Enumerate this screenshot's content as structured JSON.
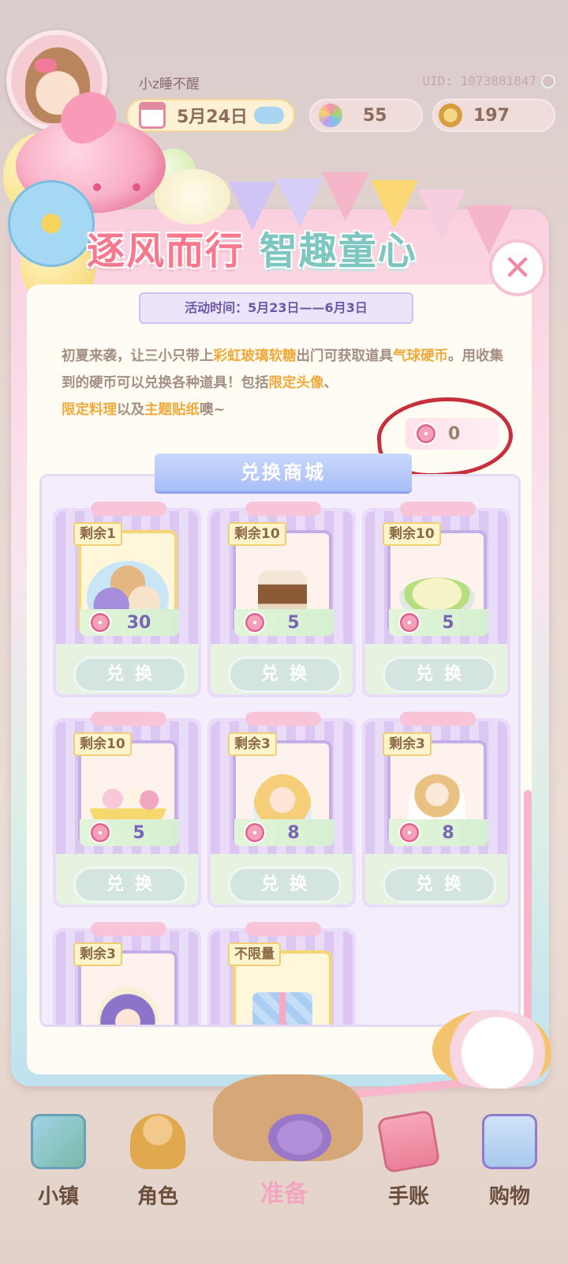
{
  "player": {
    "name": "小z睡不醒",
    "uid": "UID: 1073881847",
    "date": "5月24日",
    "gems": "55",
    "coins": "197"
  },
  "event": {
    "title_part1": "逐风而行",
    "title_part2": "智趣童心",
    "time": "活动时间：5月23日——6月3日",
    "desc": {
      "p1": "初夏来袭，让三小只带上",
      "h1": "彩虹玻璃软糖",
      "p2": "出门可获取道具",
      "h2": "气球硬币",
      "p3": "。用收集到的硬币可以兑换各种道具！包括",
      "h3": "限定头像",
      "p4": "、",
      "h4": "限定料理",
      "p5": "以及",
      "h5": "主题贴纸",
      "p6": "噢~"
    },
    "balloon_coins": "0"
  },
  "shop": {
    "title": "兑换商城",
    "redeem_label": "兑换",
    "items": [
      {
        "stock": "剩余1",
        "price": "30",
        "art": "group-portrait-icon"
      },
      {
        "stock": "剩余10",
        "price": "5",
        "art": "chocolate-drink-icon"
      },
      {
        "stock": "剩余10",
        "price": "5",
        "art": "lime-cake-icon"
      },
      {
        "stock": "剩余10",
        "price": "5",
        "art": "banana-split-icon"
      },
      {
        "stock": "剩余3",
        "price": "8",
        "art": "girl-sticker-icon"
      },
      {
        "stock": "剩余3",
        "price": "8",
        "art": "boy-sticker-icon"
      },
      {
        "stock": "剩余3",
        "price": "",
        "art": "cat-hood-sticker-icon"
      },
      {
        "stock": "不限量",
        "price": "",
        "art": "gift-box-icon"
      }
    ]
  },
  "nav": {
    "town": "小镇",
    "character": "角色",
    "prepare": "准备",
    "journal": "手账",
    "shopping": "购物"
  },
  "colors": {
    "accent_pink": "#f2a6bf",
    "highlight": "#f2a93b",
    "purple_text": "#7b63b8",
    "annotation_red": "#c5303c"
  }
}
